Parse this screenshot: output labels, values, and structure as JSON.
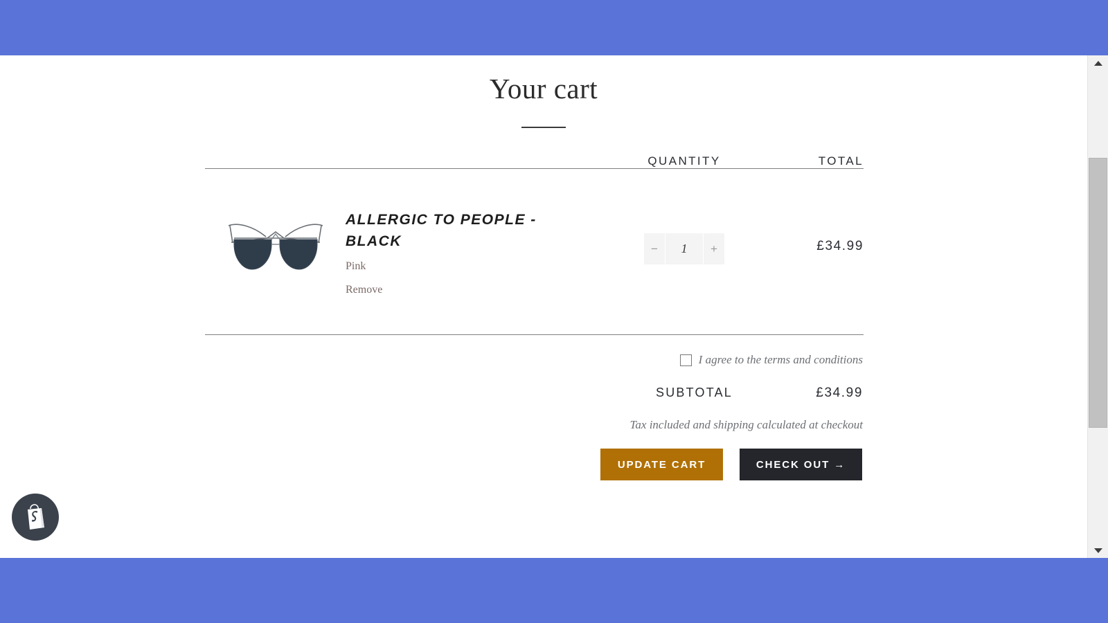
{
  "chrome": {
    "top_band_color": "#5a73d8",
    "bottom_band_color": "#5a73d8"
  },
  "page": {
    "title": "Your cart"
  },
  "table": {
    "headers": {
      "quantity": "QUANTITY",
      "total": "TOTAL"
    }
  },
  "item": {
    "name": "ALLERGIC TO PEOPLE - BLACK",
    "variant": "Pink",
    "remove_label": "Remove",
    "quantity": "1",
    "decrement_label": "−",
    "increment_label": "+",
    "line_total": "£34.99",
    "image_alt": "cat-eye-sunglasses"
  },
  "footer": {
    "terms_label": "I agree to the terms and conditions",
    "terms_checked": false,
    "subtotal_label": "SUBTOTAL",
    "subtotal_value": "£34.99",
    "tax_note": "Tax included and shipping calculated at checkout",
    "update_button": "UPDATE CART",
    "checkout_button": "CHECK OUT →"
  },
  "badge": {
    "name": "shopify-logo",
    "color": "#3b424c"
  },
  "scrollbar": {
    "up_arrow": "▲",
    "down_arrow": "▼"
  }
}
